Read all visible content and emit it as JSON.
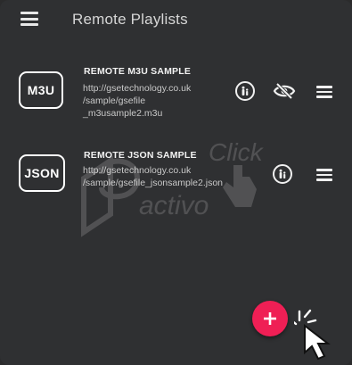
{
  "header": {
    "title": "Remote Playlists",
    "menu_icon": "hamburger-menu-icon"
  },
  "playlists": [
    {
      "badge": "M3U",
      "name": "REMOTE M3U SAMPLE",
      "url_lines": [
        "http://gsetechnology.co.uk",
        "/sample/gsefile",
        "_m3usample2.m3u"
      ],
      "actions": [
        "parental-control-icon",
        "visibility-off-icon",
        "reorder-icon"
      ]
    },
    {
      "badge": "JSON",
      "name": "REMOTE JSON SAMPLE",
      "url_lines": [
        "http://gsetechnology.co.uk",
        "/sample/gsefile_jsonsample2.json"
      ],
      "actions": [
        "parental-control-icon",
        "reorder-icon"
      ]
    }
  ],
  "fab": {
    "icon": "add-icon",
    "color": "#ef1f55"
  },
  "watermark": {
    "text": "Click activo"
  },
  "colors": {
    "background": "#2f3032",
    "text": "#ffffff",
    "accent": "#ef1f55"
  }
}
